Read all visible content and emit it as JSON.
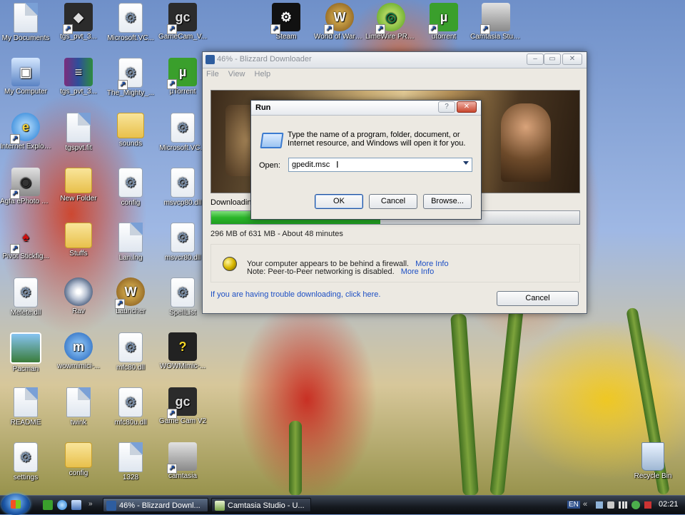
{
  "desktop": {
    "icons": [
      {
        "label": "My Documents",
        "icon": "documents-folder-icon"
      },
      {
        "label": "tgs_pvt_3...",
        "icon": "game-icon"
      },
      {
        "label": "Microsoft.VC...",
        "icon": "settings-file-icon"
      },
      {
        "label": "GameCam_V...",
        "icon": "gamecam-icon"
      },
      {
        "label": "Steam",
        "icon": "steam-icon"
      },
      {
        "label": "World of Warcraft",
        "icon": "wow-icon"
      },
      {
        "label": "LimeWire PRO 5.1.2",
        "icon": "limewire-icon"
      },
      {
        "label": "utorrent",
        "icon": "utorrent-icon"
      },
      {
        "label": "Camtasia Studio 5",
        "icon": "camtasia-icon"
      },
      {
        "label": "My Computer",
        "icon": "computer-icon"
      },
      {
        "label": "tgs_pvt_3...",
        "icon": "winrar-icon"
      },
      {
        "label": "The_Mighty_...",
        "icon": "setup-file-icon"
      },
      {
        "label": "µTorrent",
        "icon": "utorrent-icon"
      },
      {
        "label": "Internet Explorer",
        "icon": "ie-icon"
      },
      {
        "label": "tgspvt.fit",
        "icon": "file-icon"
      },
      {
        "label": "sounds",
        "icon": "folder-icon"
      },
      {
        "label": "Microsoft.VC...",
        "icon": "settings-file-icon"
      },
      {
        "label": "Agfa ePhoto 1280 Digit...",
        "icon": "camera-icon"
      },
      {
        "label": "New Folder",
        "icon": "folder-icon"
      },
      {
        "label": "config",
        "icon": "settings-file-icon"
      },
      {
        "label": "msvcp80.dll",
        "icon": "settings-file-icon"
      },
      {
        "label": "Pivot Stickfig...",
        "icon": "pivot-icon"
      },
      {
        "label": "Stuffs",
        "icon": "folder-icon"
      },
      {
        "label": "Lan.lng",
        "icon": "file-icon"
      },
      {
        "label": "msvcr80.dll",
        "icon": "settings-file-icon"
      },
      {
        "label": "Melete.dll",
        "icon": "settings-file-icon"
      },
      {
        "label": "Rav",
        "icon": "disc-icon"
      },
      {
        "label": "Launcher",
        "icon": "wow-icon"
      },
      {
        "label": "SpellList",
        "icon": "settings-file-icon"
      },
      {
        "label": "Pacman",
        "icon": "image-icon"
      },
      {
        "label": "wowmimici-...",
        "icon": "mimic-icon"
      },
      {
        "label": "mfc80.dll",
        "icon": "settings-file-icon"
      },
      {
        "label": "WOWMimic-...",
        "icon": "help-icon"
      },
      {
        "label": "README",
        "icon": "file-icon"
      },
      {
        "label": "twink",
        "icon": "file-icon"
      },
      {
        "label": "mfc80u.dll",
        "icon": "settings-file-icon"
      },
      {
        "label": "Game Cam V2",
        "icon": "gamecam-icon"
      },
      {
        "label": "settings",
        "icon": "settings-file-icon"
      },
      {
        "label": "config",
        "icon": "folder-icon"
      },
      {
        "label": "1328",
        "icon": "file-icon"
      },
      {
        "label": "camtasia",
        "icon": "camtasia-icon"
      },
      {
        "label": "Recycle Bin",
        "icon": "recycle-bin-icon"
      }
    ]
  },
  "downloader": {
    "title": "46% - Blizzard Downloader",
    "menu": [
      "File",
      "View",
      "Help"
    ],
    "status_label": "Downloading",
    "progress_fraction": 0.46,
    "progress_text": "296 MB of 631 MB - About 48 minutes",
    "firewall_line1": "Your computer appears to be behind a firewall.",
    "firewall_link1": "More Info",
    "firewall_line2": "Note: Peer-to-Peer networking is disabled.",
    "firewall_link2": "More Info",
    "trouble_link": "If you are having trouble downloading, click here.",
    "cancel_label": "Cancel"
  },
  "run_dialog": {
    "title": "Run",
    "help_btn": "?",
    "close_btn": "✕",
    "description": "Type the name of a program, folder, document, or Internet resource, and Windows will open it for you.",
    "open_label": "Open:",
    "open_value": "gpedit.msc",
    "ok_label": "OK",
    "cancel_label": "Cancel",
    "browse_label": "Browse..."
  },
  "taskbar": {
    "tasks": [
      {
        "label": "46% - Blizzard Downl..."
      },
      {
        "label": "Camtasia Studio - U..."
      }
    ],
    "language": "EN",
    "clock": "02:21"
  }
}
